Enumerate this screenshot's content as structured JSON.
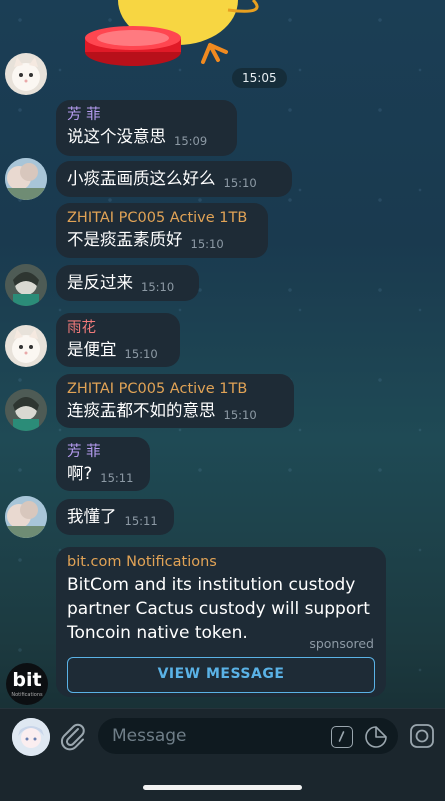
{
  "chat": {
    "sticker_time": "15:05",
    "messages": [
      {
        "sender": "芳 菲",
        "sender_color": "#b59cf0",
        "text": "说这个没意思",
        "time": "15:09"
      },
      {
        "sender": "",
        "text": "小痰盂画质这么好么",
        "time": "15:10"
      },
      {
        "sender": "ZHITAI PC005 Active 1TB",
        "sender_color": "#e1a356",
        "text": "不是痰盂素质好",
        "time": "15:10"
      },
      {
        "sender": "",
        "text": "是反过来",
        "time": "15:10"
      },
      {
        "sender": "雨花",
        "sender_color": "#f07a7a",
        "text": "是便宜",
        "time": "15:10"
      },
      {
        "sender": "ZHITAI PC005 Active 1TB",
        "sender_color": "#e1a356",
        "text": "连痰盂都不如的意思",
        "time": "15:10"
      },
      {
        "sender": "芳 菲",
        "sender_color": "#b59cf0",
        "text": "啊?",
        "time": "15:11"
      },
      {
        "sender": "",
        "text": "我懂了",
        "time": "15:11"
      }
    ],
    "sponsored": {
      "sender": "bit.com Notifications",
      "text": "BitCom and its institution custody partner Cactus custody will support Toncoin native token.",
      "label": "sponsored",
      "button": "VIEW MESSAGE",
      "logo_text": "bit",
      "logo_sub": "Notifications"
    }
  },
  "input": {
    "placeholder": "Message"
  },
  "colors": {
    "accent": "#5ab2e6",
    "bubble": "#1e2b36"
  }
}
